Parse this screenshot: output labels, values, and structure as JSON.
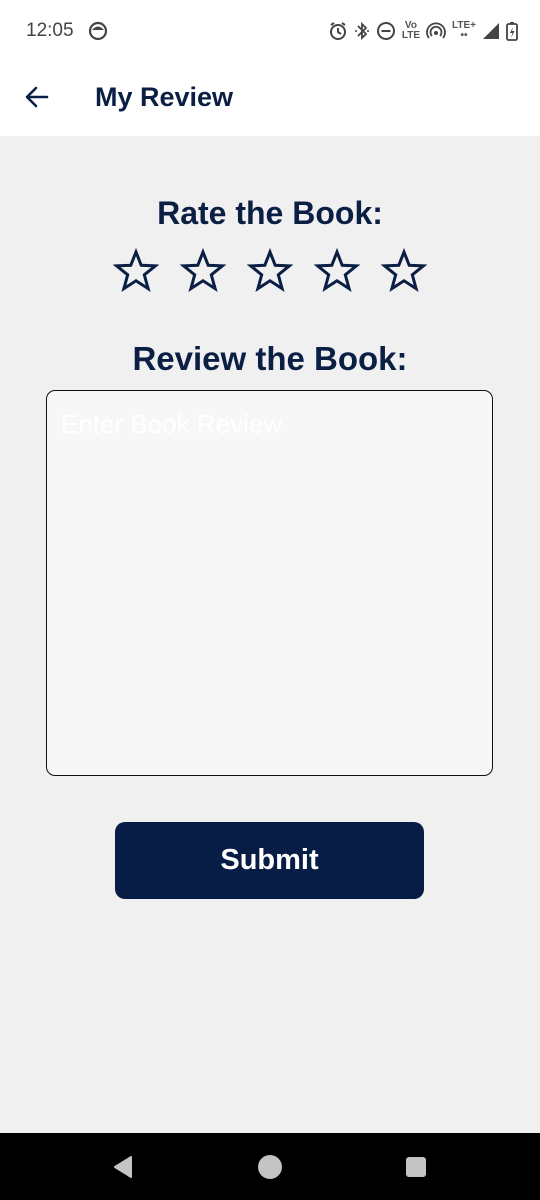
{
  "status_bar": {
    "time": "12:05",
    "volte_top": "Vo",
    "volte_bottom": "LTE",
    "network_top": "LTE+",
    "icons": [
      "camera-notification-icon",
      "alarm-icon",
      "bluetooth-icon",
      "dnd-icon",
      "volte-icon",
      "hotspot-icon",
      "lte-icon",
      "signal-icon",
      "battery-icon"
    ]
  },
  "header": {
    "title": "My Review",
    "back_icon": "arrow-left-icon"
  },
  "rating": {
    "title": "Rate the Book:",
    "max_stars": 5,
    "selected": 0,
    "star_icon": "star-outline-icon"
  },
  "review": {
    "title": "Review the Book:",
    "placeholder": "Enter Book Review",
    "value": ""
  },
  "submit": {
    "label": "Submit"
  },
  "nav": {
    "icons": [
      "back-triangle-icon",
      "home-circle-icon",
      "recents-square-icon"
    ]
  },
  "colors": {
    "brand_navy": "#071d45",
    "text_navy": "#0b1f45",
    "background": "#f0f0f0",
    "input_bg": "#f7f7f7"
  }
}
